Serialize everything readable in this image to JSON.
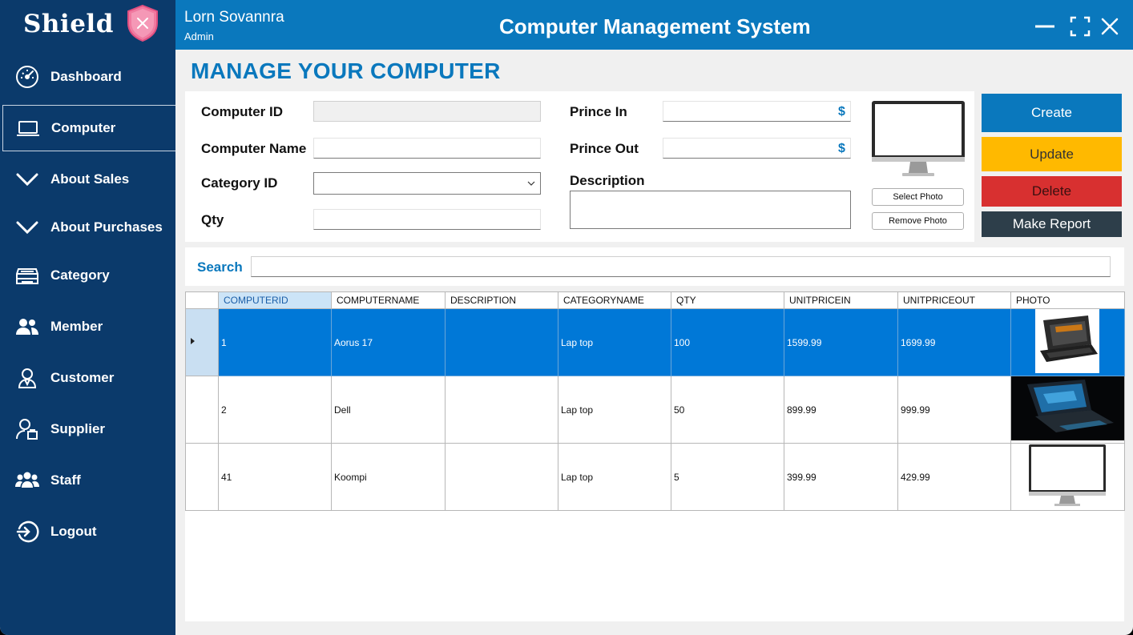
{
  "brand": {
    "name": "Shield"
  },
  "header": {
    "user_name": "Lorn Sovannra",
    "user_role": "Admin",
    "title": "Computer Management System"
  },
  "sidebar": {
    "items": [
      {
        "label": "Dashboard",
        "icon": "speedometer-icon",
        "active": false
      },
      {
        "label": "Computer",
        "icon": "laptop-icon",
        "active": true
      },
      {
        "label": "About Sales",
        "icon": "chevron-down-icon",
        "active": false
      },
      {
        "label": "About Purchases",
        "icon": "chevron-down-icon",
        "active": false
      },
      {
        "label": "Category",
        "icon": "drawer-icon",
        "active": false
      },
      {
        "label": "Member",
        "icon": "users-icon",
        "active": false
      },
      {
        "label": "Customer",
        "icon": "person-icon",
        "active": false
      },
      {
        "label": "Supplier",
        "icon": "supplier-icon",
        "active": false
      },
      {
        "label": "Staff",
        "icon": "group-icon",
        "active": false
      },
      {
        "label": "Logout",
        "icon": "logout-icon",
        "active": false
      }
    ]
  },
  "main": {
    "page_title": "MANAGE YOUR COMPUTER",
    "form": {
      "computer_id_label": "Computer ID",
      "computer_id_value": "",
      "computer_name_label": "Computer Name",
      "computer_name_value": "",
      "category_id_label": "Category ID",
      "category_id_value": "",
      "qty_label": "Qty",
      "qty_value": "",
      "price_in_label": "Prince In",
      "price_in_value": "",
      "price_out_label": "Prince Out",
      "price_out_value": "",
      "currency_symbol": "$",
      "description_label": "Description",
      "description_value": "",
      "select_photo_label": "Select Photo",
      "remove_photo_label": "Remove Photo"
    },
    "actions": {
      "create": "Create",
      "update": "Update",
      "delete": "Delete",
      "report": "Make Report"
    },
    "search": {
      "label": "Search",
      "value": ""
    },
    "grid": {
      "columns": [
        "COMPUTERID",
        "COMPUTERNAME",
        "DESCRIPTION",
        "CATEGORYNAME",
        "QTY",
        "UNITPRICEIN",
        "UNITPRICEOUT",
        "PHOTO"
      ],
      "rows": [
        {
          "id": "1",
          "name": "Aorus 17",
          "description": "",
          "category": "Lap top",
          "qty": "100",
          "price_in": "1599.99",
          "price_out": "1699.99",
          "photo": "gaming-laptop-photo"
        },
        {
          "id": "2",
          "name": "Dell",
          "description": "",
          "category": "Lap top",
          "qty": "50",
          "price_in": "899.99",
          "price_out": "999.99",
          "photo": "laptop-dark-photo"
        },
        {
          "id": "41",
          "name": "Koompi",
          "description": "",
          "category": "Lap top",
          "qty": "5",
          "price_in": "399.99",
          "price_out": "429.99",
          "photo": "monitor-photo"
        }
      ]
    }
  },
  "colors": {
    "sidebar": "#0b3a6b",
    "header": "#0a78bd",
    "create": "#0a78bd",
    "update": "#ffb900",
    "delete": "#d83030",
    "report": "#2d3e4a",
    "selected_row": "#0078d7"
  }
}
